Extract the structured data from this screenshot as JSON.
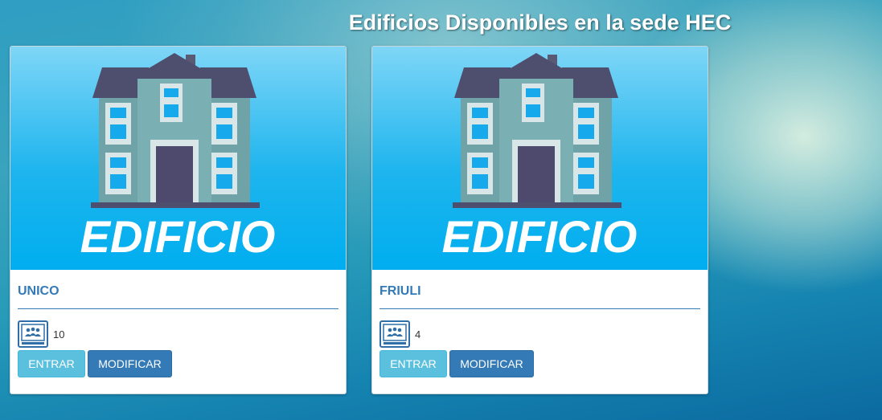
{
  "header": {
    "title": "Edificios Disponibles en la sede HEC"
  },
  "buildings": [
    {
      "name": "UNICO",
      "capacity": "10",
      "image_text": "EDIFICIO",
      "enter_label": "ENTRAR",
      "modify_label": "MODIFICAR"
    },
    {
      "name": "FRIULI",
      "capacity": "4",
      "image_text": "EDIFICIO",
      "enter_label": "ENTRAR",
      "modify_label": "MODIFICAR"
    }
  ],
  "colors": {
    "accent": "#337ab7",
    "info": "#5bc0de",
    "image_bg": "#00aeef",
    "roof": "#4e4e6e",
    "wall": "#6fa3a8"
  },
  "icons": {
    "capacity": "classroom-icon"
  }
}
